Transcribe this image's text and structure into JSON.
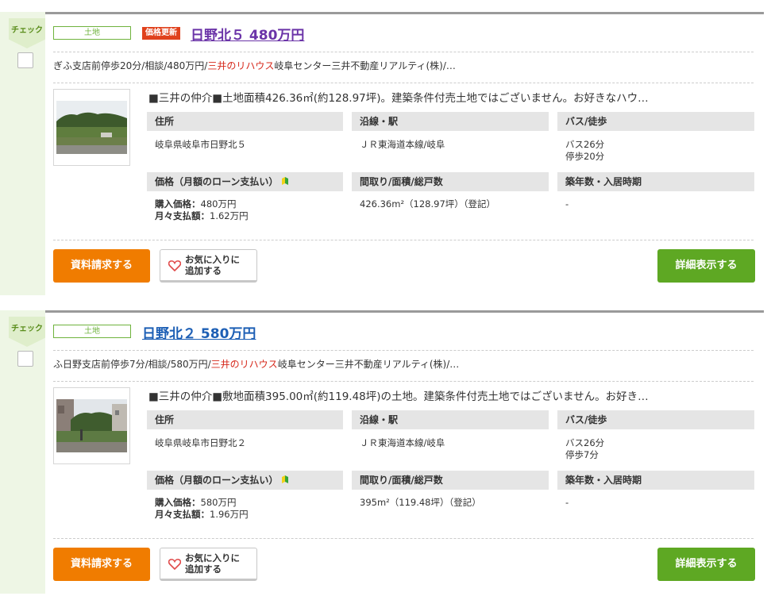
{
  "listings": [
    {
      "check_label": "チェック",
      "type_badge": "土地",
      "update_badge": "価格更新",
      "title": "日野北５ 480万円",
      "access_pre": "ぎふ支店前停歩20分/相談/480万円/",
      "access_company": "三井のリハウス",
      "access_post": "岐阜センター三井不動産リアルティ(株)/…",
      "catch": "■三井の仲介■土地面積426.36㎡(約128.97坪)。建築条件付売土地ではございません。お好きなハウ…",
      "headers": {
        "address": "住所",
        "station": "沿線・駅",
        "bus": "バス/徒歩",
        "price": "価格（月額のローン支払い）",
        "layout": "間取り/面積/総戸数",
        "age": "築年数・入居時期"
      },
      "address": "岐阜県岐阜市日野北５",
      "station": "ＪＲ東海道本線/岐阜",
      "bus_line1": "バス26分",
      "bus_line2": "停歩20分",
      "price_label": "購入価格：",
      "price_value": "480万円",
      "monthly_label": "月々支払額：",
      "monthly_value": "1.62万円",
      "area": "426.36m²（128.97坪）（登記）",
      "age": "-",
      "btn_doc": "資料請求する",
      "btn_fav_line1": "お気に入りに",
      "btn_fav_line2": "追加する",
      "btn_detail": "詳細表示する"
    },
    {
      "check_label": "チェック",
      "type_badge": "土地",
      "title": "日野北２ 580万円",
      "access_pre": "ふ日野支店前停歩7分/相談/580万円/",
      "access_company": "三井のリハウス",
      "access_post": "岐阜センター三井不動産リアルティ(株)/…",
      "catch": "■三井の仲介■敷地面積395.00㎡(約119.48坪)の土地。建築条件付売土地ではございません。お好き…",
      "headers": {
        "address": "住所",
        "station": "沿線・駅",
        "bus": "バス/徒歩",
        "price": "価格（月額のローン支払い）",
        "layout": "間取り/面積/総戸数",
        "age": "築年数・入居時期"
      },
      "address": "岐阜県岐阜市日野北２",
      "station": "ＪＲ東海道本線/岐阜",
      "bus_line1": "バス26分",
      "bus_line2": "停歩7分",
      "price_label": "購入価格：",
      "price_value": "580万円",
      "monthly_label": "月々支払額：",
      "monthly_value": "1.96万円",
      "area": "395m²（119.48坪）（登記）",
      "age": "-",
      "btn_doc": "資料請求する",
      "btn_fav_line1": "お気に入りに",
      "btn_fav_line2": "追加する",
      "btn_detail": "詳細表示する"
    }
  ]
}
